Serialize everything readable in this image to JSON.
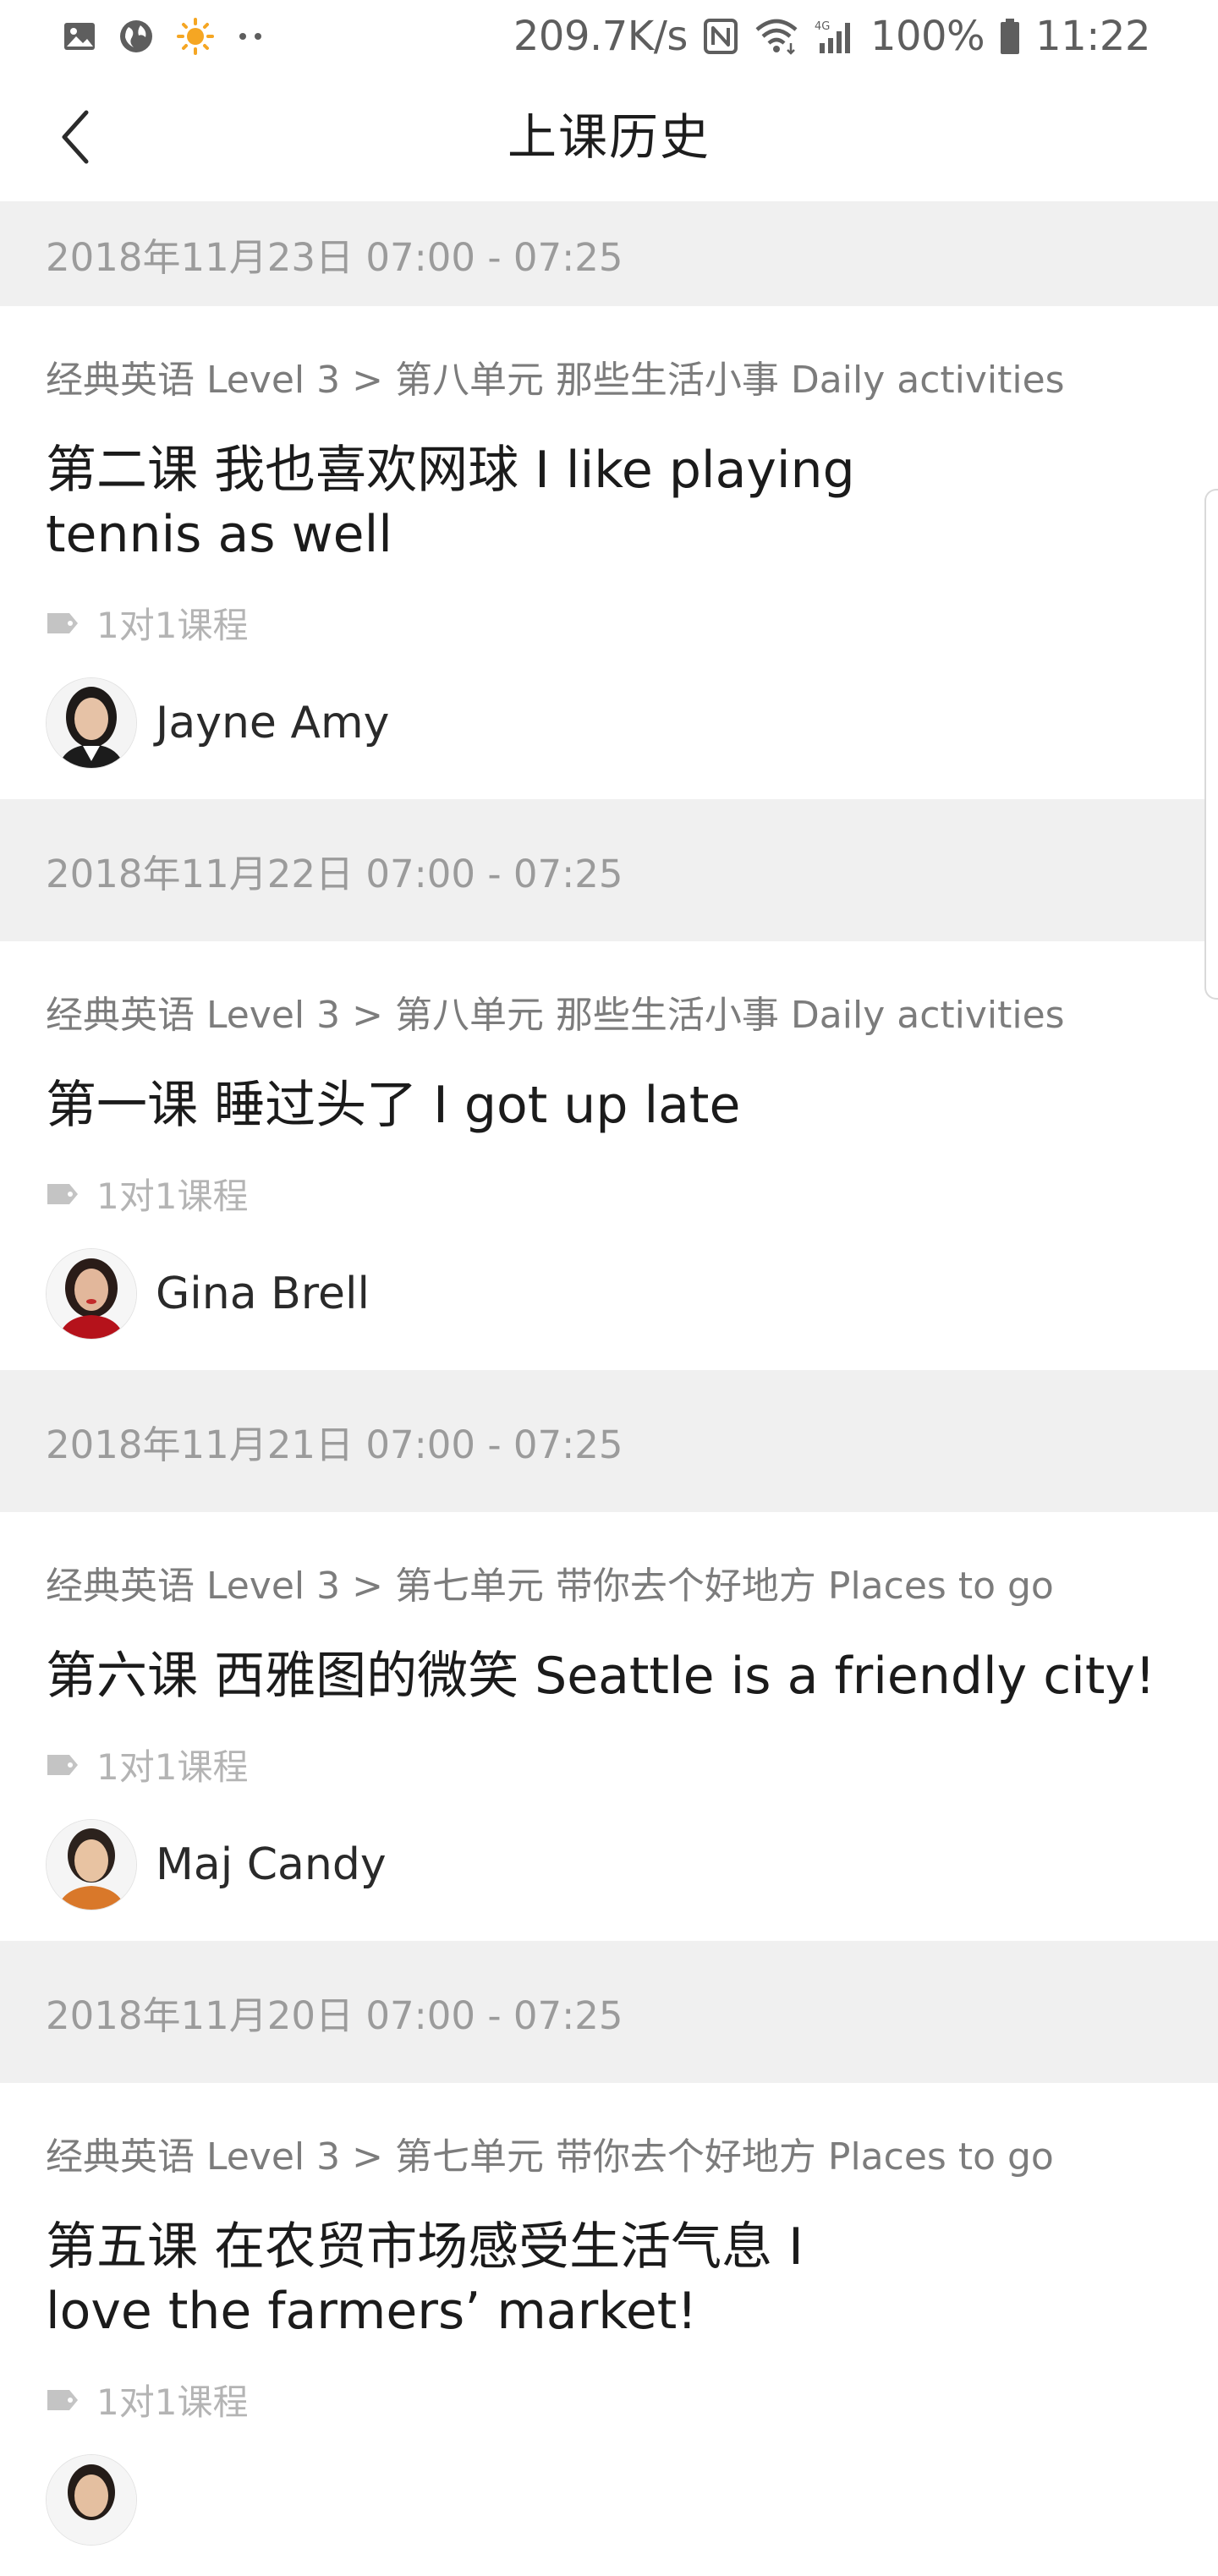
{
  "status_bar": {
    "left_icons": [
      "image-icon",
      "globe-icon",
      "sun-icon",
      "more-dots-icon"
    ],
    "net_speed": "209.7K/s",
    "nfc_icon": "nfc-icon",
    "wifi_icon": "wifi-icon",
    "signal_icon": "signal-4g-icon",
    "battery_percent": "100%",
    "battery_icon": "battery-icon",
    "time": "11:22"
  },
  "header": {
    "title": "上课历史",
    "back_icon": "chevron-left-icon"
  },
  "records": [
    {
      "date": "2018年11月23日 07:00 - 07:25",
      "course_path": "经典英语 Level 3 > 第八单元 那些生活小事 Daily activities",
      "lesson_title": "第二课 我也喜欢网球 I like playing tennis as well",
      "tag": "1对1课程",
      "teacher": "Jayne Amy"
    },
    {
      "date": "2018年11月22日 07:00 - 07:25",
      "course_path": "经典英语 Level 3 > 第八单元 那些生活小事 Daily activities",
      "lesson_title": "第一课 睡过头了 I got up late",
      "tag": "1对1课程",
      "teacher": "Gina Brell"
    },
    {
      "date": "2018年11月21日 07:00 - 07:25",
      "course_path": "经典英语 Level 3 > 第七单元 带你去个好地方 Places to go",
      "lesson_title": "第六课  西雅图的微笑 Seattle is a friendly city!",
      "tag": "1对1课程",
      "teacher": "Maj Candy"
    },
    {
      "date": "2018年11月20日 07:00 - 07:25",
      "course_path": "经典英语 Level 3 > 第七单元 带你去个好地方 Places to go",
      "lesson_title": "第五课 在农贸市场感受生活气息 I love the farmers’ market!",
      "tag": "1对1课程",
      "teacher": ""
    }
  ],
  "colors": {
    "date_bar_bg": "#f0f0f0",
    "date_text": "#9b9b9b",
    "path_text": "#7c7c7c",
    "tag_text": "#b4b4b4",
    "title_text": "#1b1b1b"
  }
}
